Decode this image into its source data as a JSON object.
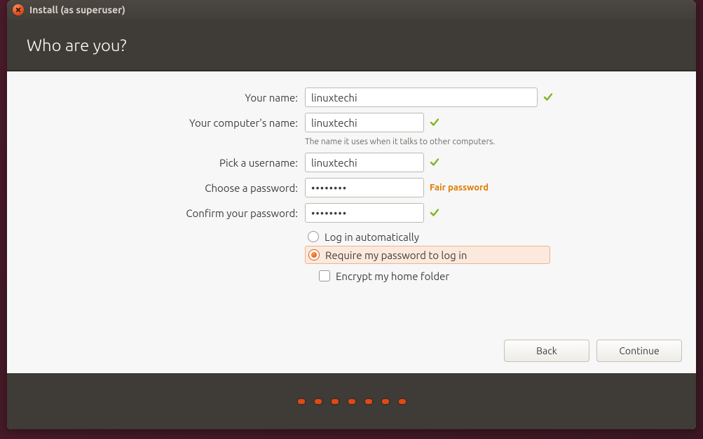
{
  "titlebar": {
    "title": "Install (as superuser)"
  },
  "header": {
    "title": "Who are you?"
  },
  "form": {
    "name": {
      "label": "Your name:",
      "value": "linuxtechi"
    },
    "host": {
      "label": "Your computer's name:",
      "value": "linuxtechi",
      "help": "The name it uses when it talks to other computers."
    },
    "user": {
      "label": "Pick a username:",
      "value": "linuxtechi"
    },
    "pass": {
      "label": "Choose a password:",
      "value": "••••••••",
      "strength": "Fair password"
    },
    "confirm": {
      "label": "Confirm your password:",
      "value": "••••••••"
    }
  },
  "options": {
    "auto_login": "Log in automatically",
    "require_password": "Require my password to log in",
    "encrypt_home": "Encrypt my home folder",
    "selected": "require_password",
    "encrypt_checked": false
  },
  "buttons": {
    "back": "Back",
    "continue": "Continue"
  },
  "progress_dots": 7
}
